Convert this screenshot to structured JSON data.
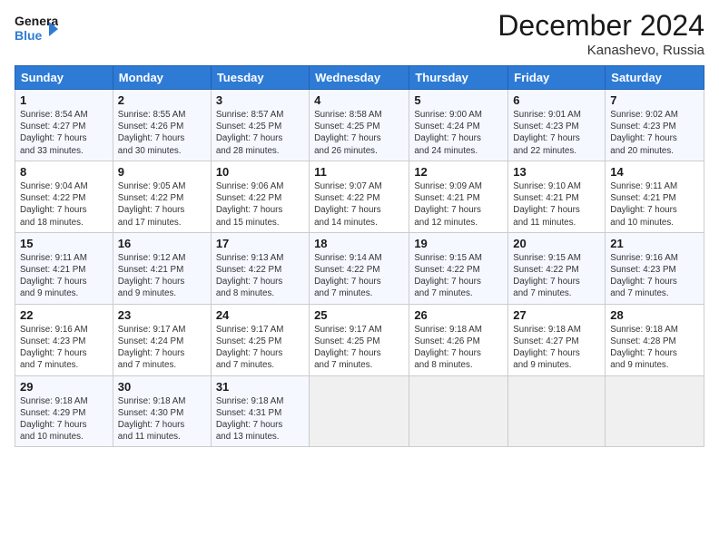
{
  "logo": {
    "line1": "General",
    "line2": "Blue",
    "icon": "▶"
  },
  "title": "December 2024",
  "location": "Kanashevo, Russia",
  "headers": [
    "Sunday",
    "Monday",
    "Tuesday",
    "Wednesday",
    "Thursday",
    "Friday",
    "Saturday"
  ],
  "weeks": [
    [
      {
        "day": "1",
        "info": "Sunrise: 8:54 AM\nSunset: 4:27 PM\nDaylight: 7 hours\nand 33 minutes."
      },
      {
        "day": "2",
        "info": "Sunrise: 8:55 AM\nSunset: 4:26 PM\nDaylight: 7 hours\nand 30 minutes."
      },
      {
        "day": "3",
        "info": "Sunrise: 8:57 AM\nSunset: 4:25 PM\nDaylight: 7 hours\nand 28 minutes."
      },
      {
        "day": "4",
        "info": "Sunrise: 8:58 AM\nSunset: 4:25 PM\nDaylight: 7 hours\nand 26 minutes."
      },
      {
        "day": "5",
        "info": "Sunrise: 9:00 AM\nSunset: 4:24 PM\nDaylight: 7 hours\nand 24 minutes."
      },
      {
        "day": "6",
        "info": "Sunrise: 9:01 AM\nSunset: 4:23 PM\nDaylight: 7 hours\nand 22 minutes."
      },
      {
        "day": "7",
        "info": "Sunrise: 9:02 AM\nSunset: 4:23 PM\nDaylight: 7 hours\nand 20 minutes."
      }
    ],
    [
      {
        "day": "8",
        "info": "Sunrise: 9:04 AM\nSunset: 4:22 PM\nDaylight: 7 hours\nand 18 minutes."
      },
      {
        "day": "9",
        "info": "Sunrise: 9:05 AM\nSunset: 4:22 PM\nDaylight: 7 hours\nand 17 minutes."
      },
      {
        "day": "10",
        "info": "Sunrise: 9:06 AM\nSunset: 4:22 PM\nDaylight: 7 hours\nand 15 minutes."
      },
      {
        "day": "11",
        "info": "Sunrise: 9:07 AM\nSunset: 4:22 PM\nDaylight: 7 hours\nand 14 minutes."
      },
      {
        "day": "12",
        "info": "Sunrise: 9:09 AM\nSunset: 4:21 PM\nDaylight: 7 hours\nand 12 minutes."
      },
      {
        "day": "13",
        "info": "Sunrise: 9:10 AM\nSunset: 4:21 PM\nDaylight: 7 hours\nand 11 minutes."
      },
      {
        "day": "14",
        "info": "Sunrise: 9:11 AM\nSunset: 4:21 PM\nDaylight: 7 hours\nand 10 minutes."
      }
    ],
    [
      {
        "day": "15",
        "info": "Sunrise: 9:11 AM\nSunset: 4:21 PM\nDaylight: 7 hours\nand 9 minutes."
      },
      {
        "day": "16",
        "info": "Sunrise: 9:12 AM\nSunset: 4:21 PM\nDaylight: 7 hours\nand 9 minutes."
      },
      {
        "day": "17",
        "info": "Sunrise: 9:13 AM\nSunset: 4:22 PM\nDaylight: 7 hours\nand 8 minutes."
      },
      {
        "day": "18",
        "info": "Sunrise: 9:14 AM\nSunset: 4:22 PM\nDaylight: 7 hours\nand 7 minutes."
      },
      {
        "day": "19",
        "info": "Sunrise: 9:15 AM\nSunset: 4:22 PM\nDaylight: 7 hours\nand 7 minutes."
      },
      {
        "day": "20",
        "info": "Sunrise: 9:15 AM\nSunset: 4:22 PM\nDaylight: 7 hours\nand 7 minutes."
      },
      {
        "day": "21",
        "info": "Sunrise: 9:16 AM\nSunset: 4:23 PM\nDaylight: 7 hours\nand 7 minutes."
      }
    ],
    [
      {
        "day": "22",
        "info": "Sunrise: 9:16 AM\nSunset: 4:23 PM\nDaylight: 7 hours\nand 7 minutes."
      },
      {
        "day": "23",
        "info": "Sunrise: 9:17 AM\nSunset: 4:24 PM\nDaylight: 7 hours\nand 7 minutes."
      },
      {
        "day": "24",
        "info": "Sunrise: 9:17 AM\nSunset: 4:25 PM\nDaylight: 7 hours\nand 7 minutes."
      },
      {
        "day": "25",
        "info": "Sunrise: 9:17 AM\nSunset: 4:25 PM\nDaylight: 7 hours\nand 7 minutes."
      },
      {
        "day": "26",
        "info": "Sunrise: 9:18 AM\nSunset: 4:26 PM\nDaylight: 7 hours\nand 8 minutes."
      },
      {
        "day": "27",
        "info": "Sunrise: 9:18 AM\nSunset: 4:27 PM\nDaylight: 7 hours\nand 9 minutes."
      },
      {
        "day": "28",
        "info": "Sunrise: 9:18 AM\nSunset: 4:28 PM\nDaylight: 7 hours\nand 9 minutes."
      }
    ],
    [
      {
        "day": "29",
        "info": "Sunrise: 9:18 AM\nSunset: 4:29 PM\nDaylight: 7 hours\nand 10 minutes."
      },
      {
        "day": "30",
        "info": "Sunrise: 9:18 AM\nSunset: 4:30 PM\nDaylight: 7 hours\nand 11 minutes."
      },
      {
        "day": "31",
        "info": "Sunrise: 9:18 AM\nSunset: 4:31 PM\nDaylight: 7 hours\nand 13 minutes."
      },
      {
        "day": "",
        "info": ""
      },
      {
        "day": "",
        "info": ""
      },
      {
        "day": "",
        "info": ""
      },
      {
        "day": "",
        "info": ""
      }
    ]
  ]
}
